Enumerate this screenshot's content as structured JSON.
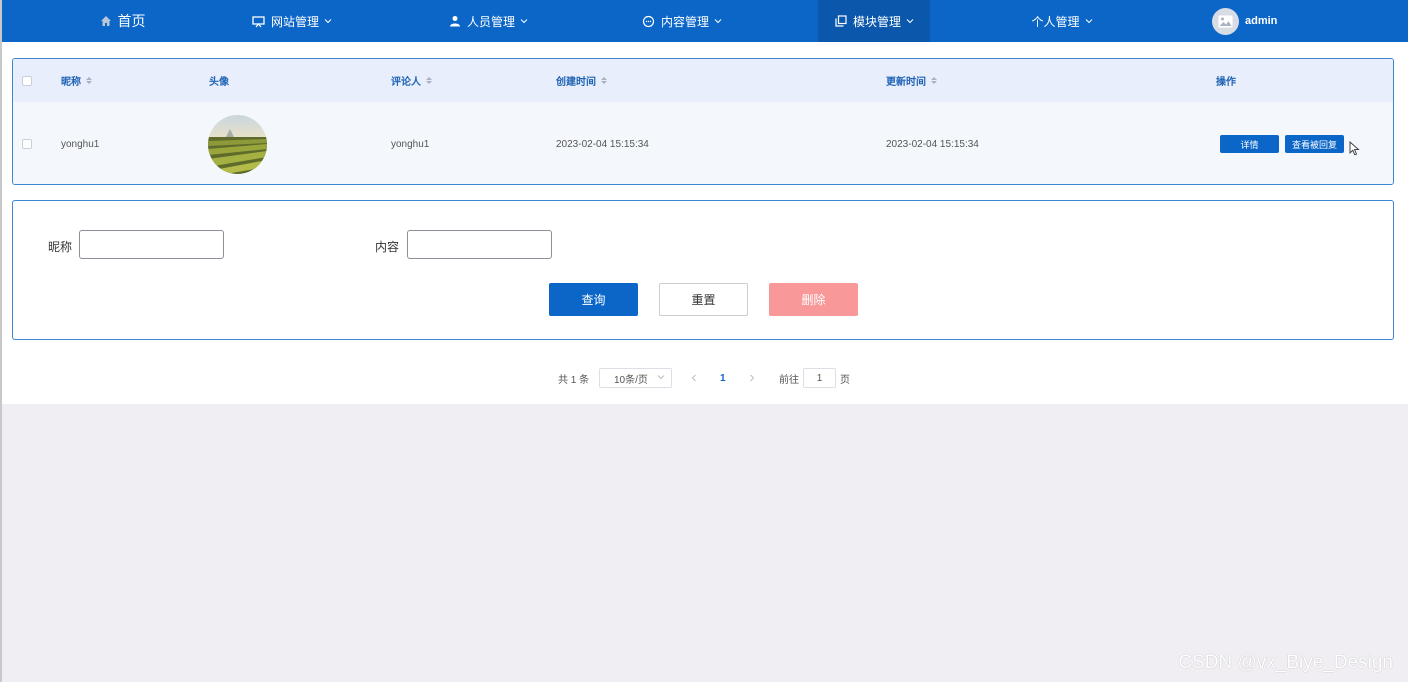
{
  "nav": {
    "items": [
      {
        "label": "首页",
        "icon": "home-icon"
      },
      {
        "label": "网站管理",
        "icon": "monitor-icon"
      },
      {
        "label": "人员管理",
        "icon": "user-icon"
      },
      {
        "label": "内容管理",
        "icon": "chat-icon"
      },
      {
        "label": "模块管理",
        "icon": "copy-icon",
        "active": true
      },
      {
        "label": "个人管理"
      }
    ],
    "user": "admin",
    "active_color": "#0a57ac",
    "bar_color": "#0b66c8"
  },
  "table": {
    "headers": {
      "nickname": "昵称",
      "avatar": "头像",
      "commenter": "评论人",
      "created": "创建时间",
      "updated": "更新时间",
      "actions": "操作"
    },
    "rows": [
      {
        "nickname": "yonghu1",
        "commenter": "yonghu1",
        "created": "2023-02-04 15:15:34",
        "updated": "2023-02-04 15:15:34",
        "btn_detail": "详情",
        "btn_reply": "查看被回复"
      }
    ]
  },
  "search": {
    "nickname_label": "昵称",
    "nickname_value": "",
    "content_label": "内容",
    "content_value": "",
    "query_btn": "查询",
    "reset_btn": "重置",
    "delete_btn": "删除"
  },
  "pagination": {
    "total": "共 1 条",
    "page_size": "10条/页",
    "current_page": "1",
    "goto_prefix": "前往",
    "goto_value": "1",
    "goto_suffix": "页"
  },
  "watermark": "CSDN @vx_Biye_Design"
}
